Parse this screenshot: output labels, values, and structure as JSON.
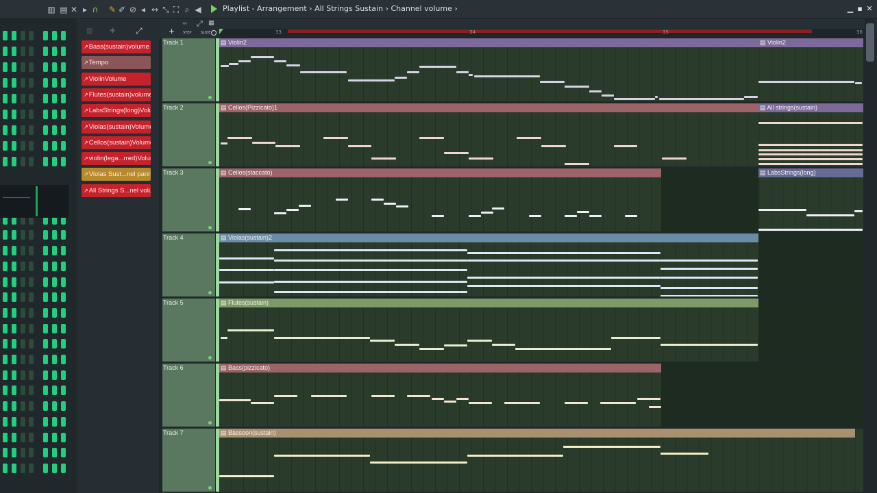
{
  "window": {
    "title": "Playlist - Arrangement",
    "breadcrumb_1": "All Strings Sustain",
    "breadcrumb_2": "Channel volume",
    "title_sep": "›"
  },
  "ruler": {
    "bar_a": "33",
    "bar_b": "34",
    "bar_c": "35",
    "bar_d": "36",
    "step_label": "STEP",
    "slide_label": "SLIDE"
  },
  "automation_items": [
    {
      "label": "Bass(sustain)volume",
      "color": "#c6222c"
    },
    {
      "label": "Tempo",
      "color": "#8c5658"
    },
    {
      "label": "ViolinVolume",
      "color": "#c6222c"
    },
    {
      "label": "Flutes(sustain)volume",
      "color": "#c6222c"
    },
    {
      "label": "LabsStrings(long)Volume",
      "color": "#c6222c"
    },
    {
      "label": "Violas(sustain)Volume",
      "color": "#c6222c"
    },
    {
      "label": "Cellos(sustain)Volume",
      "color": "#c6222c"
    },
    {
      "label": "violin(lega...rred)Volume",
      "color": "#c6222c"
    },
    {
      "label": "Violas Sust...nel panning",
      "color": "#b78a2c"
    },
    {
      "label": "All Strings S...nel volume",
      "color": "#c6222c"
    }
  ],
  "tracks": [
    {
      "name": "Track 1",
      "clips": [
        {
          "label": "Violin2",
          "color": "#7e6a9a"
        },
        {
          "label": "Violin2",
          "color": "#7e6a9a"
        }
      ]
    },
    {
      "name": "Track 2",
      "clips": [
        {
          "label": "Cellos(Pizzicato)1",
          "color": "#9c6466"
        },
        {
          "label": "All strings(sustain)",
          "color": "#7e6a9a"
        }
      ]
    },
    {
      "name": "Track 3",
      "clips": [
        {
          "label": "Cellos(staccato)",
          "color": "#9c6466"
        },
        {
          "label": "LabsStrings(long)",
          "color": "#6a6a96"
        }
      ]
    },
    {
      "name": "Track 4",
      "clips": [
        {
          "label": "Violas(sustain)2",
          "color": "#6a8ca4"
        }
      ]
    },
    {
      "name": "Track 5",
      "clips": [
        {
          "label": "Flutes(sustain)",
          "color": "#7e9a68"
        }
      ]
    },
    {
      "name": "Track 6",
      "clips": [
        {
          "label": "Bass(pizzicato)",
          "color": "#9c6466"
        }
      ]
    },
    {
      "name": "Track 7",
      "clips": [
        {
          "label": "Bassoon(sustain)",
          "color": "#a89070"
        }
      ]
    }
  ]
}
